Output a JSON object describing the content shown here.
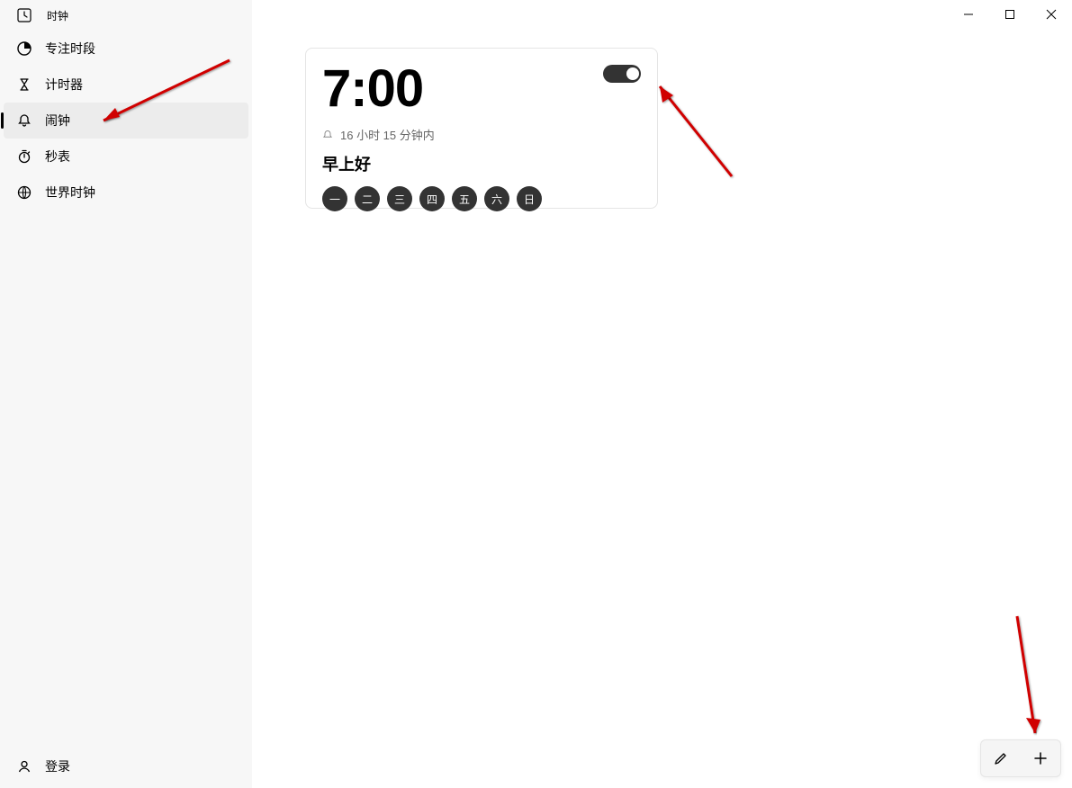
{
  "title_bar": {
    "app_name": "时钟"
  },
  "sidebar": {
    "items": [
      {
        "label": "专注时段",
        "selected": false
      },
      {
        "label": "计时器",
        "selected": false
      },
      {
        "label": "闹钟",
        "selected": true
      },
      {
        "label": "秒表",
        "selected": false
      },
      {
        "label": "世界时钟",
        "selected": false
      }
    ],
    "login_label": "登录"
  },
  "alarm": {
    "time": "7:00",
    "toggle_on": true,
    "remaining": "16 小时 15 分钟内",
    "label": "早上好",
    "days": [
      "一",
      "二",
      "三",
      "四",
      "五",
      "六",
      "日"
    ]
  },
  "colors": {
    "chip_bg": "#333333",
    "card_border": "#e5e5e5"
  }
}
